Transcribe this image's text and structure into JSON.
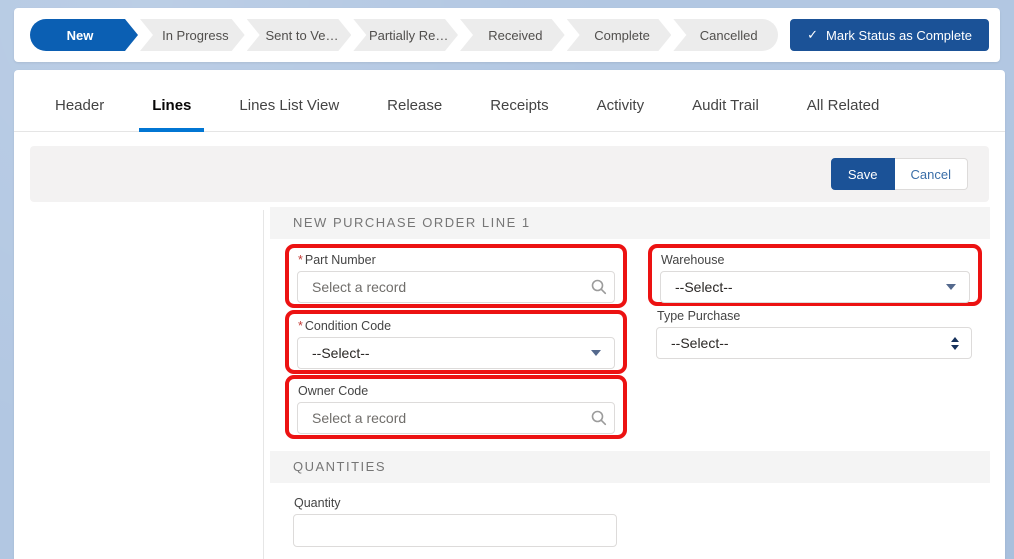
{
  "path_bar": {
    "stages": [
      {
        "label": "New",
        "state": "current"
      },
      {
        "label": "In Progress",
        "state": "incomplete"
      },
      {
        "label": "Sent to Ve…",
        "state": "incomplete"
      },
      {
        "label": "Partially Re…",
        "state": "incomplete"
      },
      {
        "label": "Received",
        "state": "incomplete"
      },
      {
        "label": "Complete",
        "state": "incomplete"
      },
      {
        "label": "Cancelled",
        "state": "incomplete"
      }
    ],
    "check_glyph": "✓",
    "mark_complete_label": "Mark Status as Complete"
  },
  "tabs": [
    {
      "label": "Header"
    },
    {
      "label": "Lines",
      "active": true
    },
    {
      "label": "Lines List View"
    },
    {
      "label": "Release"
    },
    {
      "label": "Receipts"
    },
    {
      "label": "Activity"
    },
    {
      "label": "Audit Trail"
    },
    {
      "label": "All Related"
    }
  ],
  "toolbar": {
    "save_label": "Save",
    "cancel_label": "Cancel"
  },
  "form": {
    "section1_title": "NEW PURCHASE ORDER LINE 1",
    "section2_title": "QUANTITIES",
    "fields": {
      "part_number": {
        "label": "Part Number",
        "required_marker": "*",
        "placeholder": "Select a record",
        "type": "lookup",
        "highlighted": true
      },
      "warehouse": {
        "label": "Warehouse",
        "value": "--Select--",
        "type": "picklist",
        "highlighted": true
      },
      "condition_code": {
        "label": "Condition Code",
        "required_marker": "*",
        "value": "--Select--",
        "type": "picklist",
        "highlighted": true
      },
      "type_purchase": {
        "label": "Type Purchase",
        "value": "--Select--",
        "type": "select",
        "highlighted": false
      },
      "owner_code": {
        "label": "Owner Code",
        "placeholder": "Select a record",
        "type": "lookup",
        "highlighted": true
      },
      "quantity": {
        "label": "Quantity",
        "value": ""
      }
    }
  },
  "colors": {
    "page_background": "#b2c7e2",
    "path_active_blue": "#0b5fb3",
    "button_navy": "#1b5297",
    "tab_underline_blue": "#0176d3",
    "highlight_red": "#ec1212",
    "band_gray": "#f4f4f4"
  }
}
